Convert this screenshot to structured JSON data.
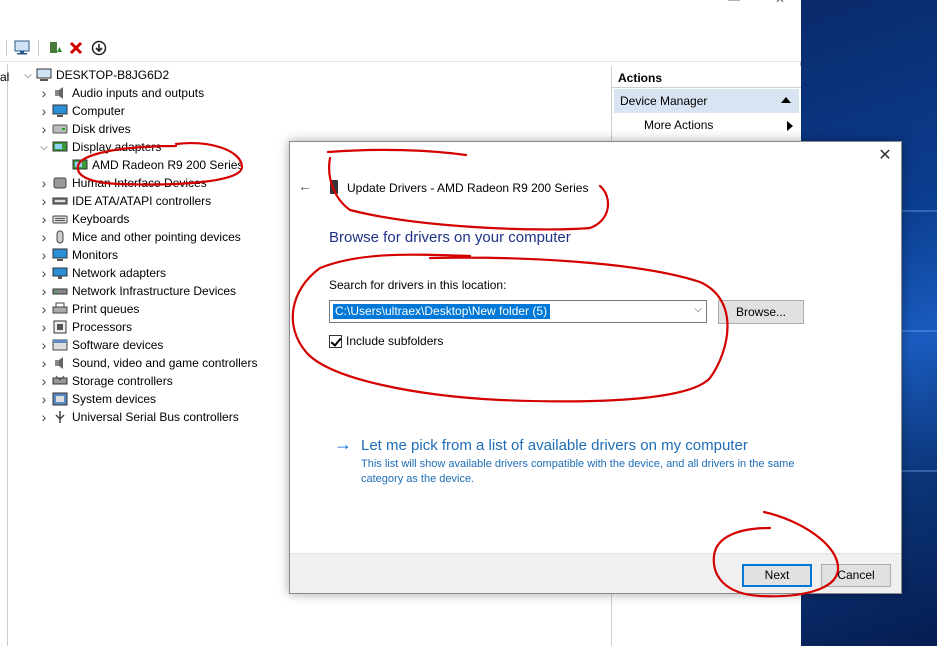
{
  "device_manager": {
    "computer_name": "DESKTOP-B8JG6D2",
    "left_sliver_text": "al",
    "tree": [
      {
        "label": "Audio inputs and outputs",
        "icon": "speaker-icon",
        "expanded": false
      },
      {
        "label": "Computer",
        "icon": "monitor-icon",
        "expanded": false
      },
      {
        "label": "Disk drives",
        "icon": "disk-icon",
        "expanded": false
      },
      {
        "label": "Display adapters",
        "icon": "display-adapter-icon",
        "expanded": true
      },
      {
        "label": "AMD Radeon R9 200 Series",
        "icon": "display-adapter-icon",
        "child": true
      },
      {
        "label": "Human Interface Devices",
        "icon": "hid-icon",
        "expanded": false
      },
      {
        "label": "IDE ATA/ATAPI controllers",
        "icon": "ide-icon",
        "expanded": false
      },
      {
        "label": "Keyboards",
        "icon": "keyboard-icon",
        "expanded": false
      },
      {
        "label": "Mice and other pointing devices",
        "icon": "mouse-icon",
        "expanded": false
      },
      {
        "label": "Monitors",
        "icon": "monitor-icon",
        "expanded": false
      },
      {
        "label": "Network adapters",
        "icon": "network-icon",
        "expanded": false
      },
      {
        "label": "Network Infrastructure Devices",
        "icon": "network-infra-icon",
        "expanded": false
      },
      {
        "label": "Print queues",
        "icon": "printer-icon",
        "expanded": false
      },
      {
        "label": "Processors",
        "icon": "processor-icon",
        "expanded": false
      },
      {
        "label": "Software devices",
        "icon": "software-icon",
        "expanded": false
      },
      {
        "label": "Sound, video and game controllers",
        "icon": "speaker-icon",
        "expanded": false
      },
      {
        "label": "Storage controllers",
        "icon": "storage-icon",
        "expanded": false
      },
      {
        "label": "System devices",
        "icon": "system-icon",
        "expanded": false
      },
      {
        "label": "Universal Serial Bus controllers",
        "icon": "usb-icon",
        "expanded": false
      }
    ]
  },
  "actions": {
    "header": "Actions",
    "section": "Device Manager",
    "more": "More Actions"
  },
  "dialog": {
    "title": "Update Drivers - AMD Radeon R9 200 Series",
    "heading": "Browse for drivers on your computer",
    "search_label": "Search for drivers in this location:",
    "path_value": "C:\\Users\\ultraex\\Desktop\\New folder (5)",
    "browse_label": "Browse...",
    "include_subfolders": "Include subfolders",
    "pick_link": "Let me pick from a list of available drivers on my computer",
    "pick_desc": "This list will show available drivers compatible with the device, and all drivers in the same category as the device.",
    "next_label": "Next",
    "cancel_label": "Cancel"
  },
  "colors": {
    "accent": "#0078d7",
    "link": "#1e6db6",
    "heading": "#1e3287",
    "annotation": "#d40000"
  }
}
